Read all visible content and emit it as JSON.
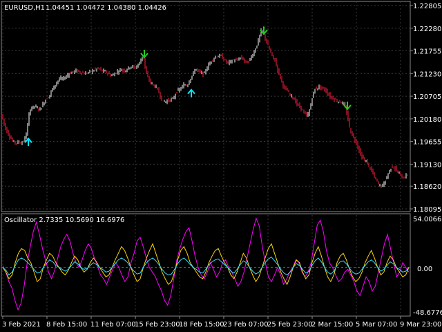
{
  "header": {
    "symbol_label": "EURUSD,H1",
    "ohlc": "1.04451 1.04472 1.04380 1.04426"
  },
  "oscillator": {
    "title": "Oscillator 2.7335 10.5690 16.6976",
    "ymax_label": "54.0066",
    "zero_label": "0.00",
    "ymin_label": "-48.6776"
  },
  "colors": {
    "background": "#000000",
    "grid": "#3a3a3a",
    "bull_candle": "#ffffff",
    "bear_candle": "#ff2040",
    "arrow_up": "#00e5ff",
    "arrow_down": "#22cc22",
    "osc_magenta": "#ff00ff",
    "osc_yellow": "#ffd700",
    "osc_cyan": "#33e0ff",
    "osc_zero": "#666666"
  },
  "chart_data": [
    {
      "type": "candlestick",
      "title": "",
      "symbol": "EURUSD",
      "timeframe": "H1",
      "y_ticks": [
        "1.22805",
        "1.22280",
        "1.21755",
        "1.21230",
        "1.20705",
        "1.20180",
        "1.19655",
        "1.19130",
        "1.18620",
        "1.18095"
      ],
      "ylim": [
        1.18095,
        1.22805
      ],
      "x_ticks": [
        "3 Feb 2021",
        "8 Feb 15:00",
        "11 Feb 07:00",
        "15 Feb 23:00",
        "18 Feb 15:00",
        "23 Feb 07:00",
        "25 Feb 23:00",
        "2 Mar 15:00",
        "5 Mar 07:00",
        "9 Mar 23:00"
      ],
      "price_path": [
        [
          0,
          1.204
        ],
        [
          4,
          1.2025
        ],
        [
          8,
          1.2
        ],
        [
          12,
          1.1985
        ],
        [
          16,
          1.1975
        ],
        [
          20,
          1.1965
        ],
        [
          24,
          1.1962
        ],
        [
          28,
          1.1965
        ],
        [
          32,
          1.1962
        ],
        [
          36,
          1.1968
        ],
        [
          40,
          1.199
        ],
        [
          44,
          1.204
        ],
        [
          48,
          1.2045
        ],
        [
          52,
          1.2048
        ],
        [
          56,
          1.204
        ],
        [
          60,
          1.2042
        ],
        [
          64,
          1.2055
        ],
        [
          68,
          1.2065
        ],
        [
          72,
          1.207
        ],
        [
          76,
          1.2085
        ],
        [
          80,
          1.2095
        ],
        [
          84,
          1.2105
        ],
        [
          88,
          1.2112
        ],
        [
          92,
          1.211
        ],
        [
          96,
          1.2115
        ],
        [
          100,
          1.2122
        ],
        [
          104,
          1.2125
        ],
        [
          108,
          1.2128
        ],
        [
          112,
          1.213
        ],
        [
          116,
          1.2126
        ],
        [
          120,
          1.2125
        ],
        [
          124,
          1.2122
        ],
        [
          128,
          1.2125
        ],
        [
          132,
          1.2128
        ],
        [
          136,
          1.213
        ],
        [
          140,
          1.2133
        ],
        [
          144,
          1.2135
        ],
        [
          148,
          1.213
        ],
        [
          152,
          1.2128
        ],
        [
          156,
          1.2125
        ],
        [
          160,
          1.212
        ],
        [
          164,
          1.2118
        ],
        [
          168,
          1.2125
        ],
        [
          172,
          1.2128
        ],
        [
          176,
          1.2133
        ],
        [
          180,
          1.213
        ],
        [
          184,
          1.2132
        ],
        [
          188,
          1.2138
        ],
        [
          192,
          1.214
        ],
        [
          196,
          1.2135
        ],
        [
          200,
          1.2142
        ],
        [
          204,
          1.215
        ],
        [
          208,
          1.2168
        ],
        [
          210,
          1.215
        ],
        [
          212,
          1.2125
        ],
        [
          216,
          1.211
        ],
        [
          220,
          1.21
        ],
        [
          224,
          1.2095
        ],
        [
          228,
          1.209
        ],
        [
          232,
          1.2075
        ],
        [
          236,
          1.206
        ],
        [
          240,
          1.2058
        ],
        [
          244,
          1.206
        ],
        [
          248,
          1.2062
        ],
        [
          252,
          1.2065
        ],
        [
          256,
          1.208
        ],
        [
          260,
          1.2085
        ],
        [
          264,
          1.209
        ],
        [
          268,
          1.2098
        ],
        [
          272,
          1.2095
        ],
        [
          276,
          1.211
        ],
        [
          280,
          1.212
        ],
        [
          284,
          1.2135
        ],
        [
          288,
          1.2128
        ],
        [
          292,
          1.2125
        ],
        [
          296,
          1.212
        ],
        [
          300,
          1.2135
        ],
        [
          304,
          1.2145
        ],
        [
          308,
          1.2155
        ],
        [
          312,
          1.216
        ],
        [
          316,
          1.2162
        ],
        [
          320,
          1.2165
        ],
        [
          324,
          1.2158
        ],
        [
          328,
          1.215
        ],
        [
          332,
          1.2148
        ],
        [
          336,
          1.2152
        ],
        [
          340,
          1.2155
        ],
        [
          344,
          1.2152
        ],
        [
          348,
          1.216
        ],
        [
          352,
          1.2158
        ],
        [
          356,
          1.215
        ],
        [
          360,
          1.2148
        ],
        [
          364,
          1.216
        ],
        [
          368,
          1.217
        ],
        [
          372,
          1.2185
        ],
        [
          376,
          1.2205
        ],
        [
          380,
          1.2225
        ],
        [
          384,
          1.221
        ],
        [
          388,
          1.219
        ],
        [
          392,
          1.2175
        ],
        [
          396,
          1.216
        ],
        [
          400,
          1.215
        ],
        [
          404,
          1.2125
        ],
        [
          408,
          1.211
        ],
        [
          412,
          1.209
        ],
        [
          416,
          1.2085
        ],
        [
          420,
          1.2075
        ],
        [
          424,
          1.207
        ],
        [
          428,
          1.206
        ],
        [
          432,
          1.205
        ],
        [
          436,
          1.2045
        ],
        [
          440,
          1.2035
        ],
        [
          444,
          1.2025
        ],
        [
          448,
          1.203
        ],
        [
          452,
          1.206
        ],
        [
          456,
          1.2085
        ],
        [
          460,
          1.209
        ],
        [
          464,
          1.2092
        ],
        [
          468,
          1.2088
        ],
        [
          472,
          1.2085
        ],
        [
          476,
          1.2075
        ],
        [
          480,
          1.2068
        ],
        [
          484,
          1.2065
        ],
        [
          488,
          1.206
        ],
        [
          492,
          1.2058
        ],
        [
          496,
          1.2055
        ],
        [
          500,
          1.205
        ],
        [
          504,
          1.2025
        ],
        [
          508,
          1.199
        ],
        [
          512,
          1.1978
        ],
        [
          516,
          1.1965
        ],
        [
          520,
          1.195
        ],
        [
          524,
          1.193
        ],
        [
          528,
          1.1925
        ],
        [
          532,
          1.1918
        ],
        [
          536,
          1.1905
        ],
        [
          540,
          1.1895
        ],
        [
          544,
          1.188
        ],
        [
          548,
          1.187
        ],
        [
          552,
          1.1862
        ],
        [
          556,
          1.1865
        ],
        [
          560,
          1.188
        ],
        [
          564,
          1.1895
        ],
        [
          568,
          1.1908
        ],
        [
          572,
          1.1905
        ],
        [
          576,
          1.1895
        ],
        [
          580,
          1.189
        ],
        [
          584,
          1.188
        ],
        [
          588,
          1.1885
        ],
        [
          592,
          1.189
        ]
      ],
      "arrows": [
        {
          "x": 41,
          "price": 1.1955,
          "dir": "up"
        },
        {
          "x": 209,
          "price": 1.2178,
          "dir": "down"
        },
        {
          "x": 277,
          "price": 1.2068,
          "dir": "up"
        },
        {
          "x": 382,
          "price": 1.2232,
          "dir": "down"
        },
        {
          "x": 503,
          "price": 1.2058,
          "dir": "down"
        }
      ]
    },
    {
      "type": "line",
      "title": "",
      "ylim": [
        -48.6776,
        54.0066
      ],
      "zero_line": 0,
      "series": [
        {
          "color": "magenta",
          "values": [
            2,
            -5,
            -15,
            -22,
            -35,
            -45,
            -38,
            -20,
            5,
            22,
            38,
            48,
            35,
            20,
            8,
            -5,
            -12,
            -3,
            10,
            22,
            30,
            35,
            28,
            15,
            5,
            0,
            8,
            18,
            25,
            20,
            10,
            2,
            -8,
            -12,
            -18,
            -10,
            -2,
            5,
            0,
            -8,
            -15,
            -10,
            5,
            15,
            28,
            32,
            22,
            10,
            0,
            -5,
            -10,
            -18,
            -25,
            -35,
            -40,
            -30,
            -12,
            8,
            20,
            30,
            38,
            42,
            28,
            12,
            0,
            -8,
            -12,
            -5,
            5,
            -2,
            -10,
            -5,
            5,
            8,
            0,
            -5,
            -12,
            -20,
            -15,
            -5,
            10,
            25,
            40,
            52,
            44,
            22,
            5,
            -10,
            -15,
            -8,
            0,
            -8,
            -18,
            -12,
            -5,
            0,
            8,
            5,
            -5,
            -10,
            -5,
            5,
            25,
            45,
            50,
            38,
            18,
            5,
            0,
            -8,
            -15,
            -12,
            -5,
            -2,
            -8,
            -15,
            -25,
            -30,
            -20,
            -10,
            -15,
            -25,
            -20,
            -5,
            10,
            25,
            35,
            20,
            5,
            -10,
            -5,
            5,
            0,
            -5
          ]
        },
        {
          "color": "yellow",
          "values": [
            0,
            -5,
            -12,
            -8,
            5,
            15,
            20,
            18,
            10,
            5,
            -5,
            -15,
            -12,
            0,
            8,
            15,
            12,
            5,
            0,
            -5,
            -8,
            -3,
            5,
            12,
            8,
            0,
            -5,
            -2,
            5,
            10,
            6,
            0,
            -5,
            -10,
            -8,
            0,
            8,
            15,
            22,
            18,
            10,
            0,
            -8,
            -15,
            -12,
            0,
            10,
            18,
            25,
            15,
            5,
            -5,
            -12,
            -18,
            -15,
            -5,
            8,
            18,
            22,
            15,
            5,
            0,
            -5,
            -10,
            -12,
            -5,
            5,
            12,
            18,
            20,
            12,
            5,
            0,
            -8,
            -12,
            -5,
            5,
            15,
            10,
            0,
            -8,
            -15,
            -10,
            0,
            10,
            20,
            25,
            15,
            5,
            -5,
            -12,
            -18,
            -10,
            0,
            8,
            5,
            -5,
            -12,
            -8,
            5,
            15,
            22,
            12,
            0,
            -10,
            -15,
            -8,
            5,
            12,
            15,
            8,
            -2,
            -10,
            -15,
            -12,
            -5,
            5,
            12,
            18,
            10,
            0,
            -8,
            -5,
            5,
            12,
            8,
            0,
            -5,
            -10,
            -8,
            0
          ]
        },
        {
          "color": "cyan",
          "values": [
            0,
            -3,
            -8,
            -5,
            2,
            8,
            10,
            8,
            5,
            2,
            -2,
            -6,
            -5,
            0,
            4,
            8,
            6,
            2,
            0,
            -2,
            -4,
            -2,
            2,
            6,
            4,
            0,
            -2,
            -1,
            2,
            5,
            3,
            0,
            -2,
            -5,
            -4,
            0,
            4,
            8,
            10,
            8,
            5,
            0,
            -4,
            -7,
            -6,
            0,
            5,
            8,
            10,
            7,
            3,
            -2,
            -6,
            -8,
            -7,
            -2,
            4,
            8,
            10,
            7,
            3,
            0,
            -2,
            -5,
            -6,
            -2,
            3,
            6,
            8,
            9,
            6,
            3,
            0,
            -4,
            -6,
            -2,
            3,
            7,
            5,
            0,
            -4,
            -7,
            -5,
            0,
            5,
            9,
            11,
            7,
            3,
            -2,
            -6,
            -8,
            -5,
            0,
            4,
            2,
            -2,
            -6,
            -4,
            2,
            7,
            10,
            6,
            0,
            -5,
            -7,
            -4,
            2,
            6,
            7,
            4,
            -1,
            -5,
            -7,
            -6,
            -2,
            2,
            6,
            8,
            5,
            0,
            -4,
            -2,
            2,
            6,
            4,
            0,
            -2,
            -5,
            -4,
            0
          ]
        }
      ]
    }
  ]
}
